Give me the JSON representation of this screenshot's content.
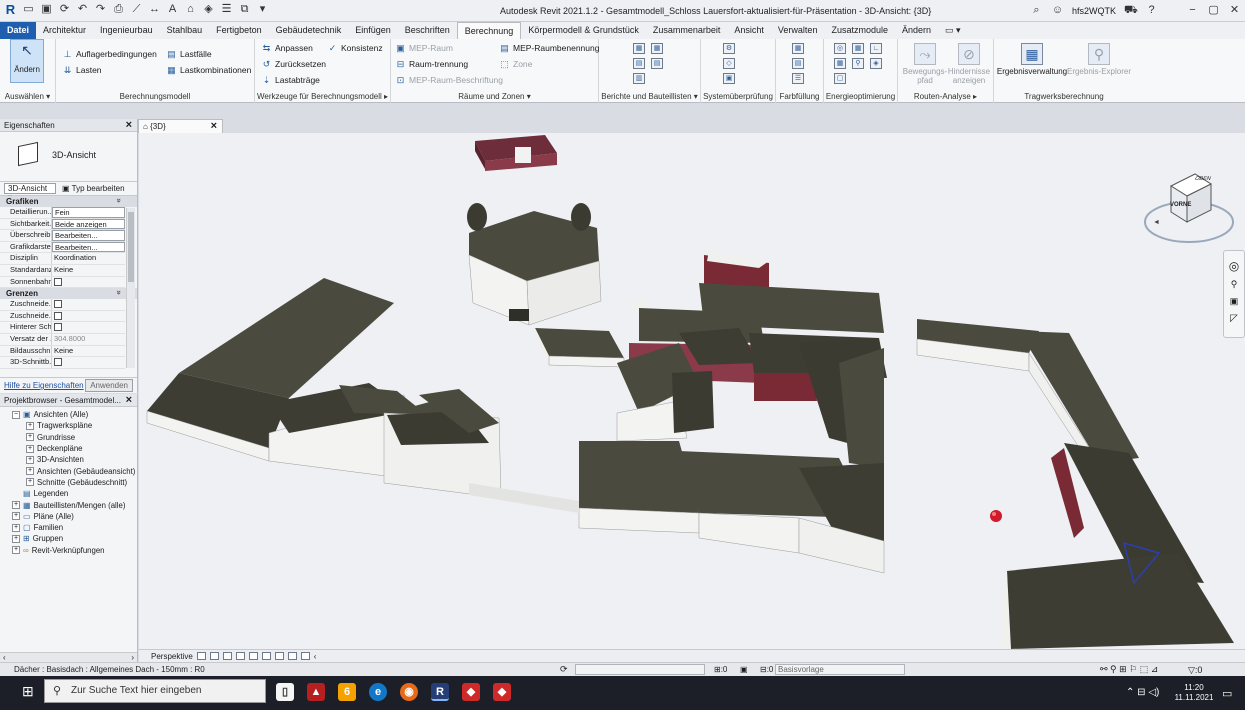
{
  "app": {
    "title": "Autodesk Revit 2021.1.2 - Gesamtmodell_Schloss Lauersfort-aktualisiert-für-Präsentation - 3D-Ansicht: {3D}",
    "user": "hfs2WQTK"
  },
  "tabs": [
    "Datei",
    "Architektur",
    "Ingenieurbau",
    "Stahlbau",
    "Fertigbeton",
    "Gebäudetechnik",
    "Einfügen",
    "Beschriften",
    "Berechnung",
    "Körpermodell & Grundstück",
    "Zusammenarbeit",
    "Ansicht",
    "Verwalten",
    "Zusatzmodule",
    "Ändern"
  ],
  "active_tab": "Berechnung",
  "ribbon": {
    "modify": "Ändern",
    "select": "Auswählen",
    "g1": {
      "items": [
        "Auflagerbedingungen",
        "Lasten"
      ],
      "items2": [
        "Lastfälle",
        "Lastkombinationen"
      ],
      "label": "Berechnungsmodell"
    },
    "g2": {
      "items": [
        "Anpassen",
        "Zurücksetzen",
        "Lastabträge"
      ],
      "items2": [
        "Konsistenz"
      ],
      "label": "Werkzeuge für Berechnungsmodell"
    },
    "g3": {
      "items": [
        "MEP-Raum",
        "Raum-trennung",
        "MEP-Raum-Beschriftung"
      ],
      "items2": [
        "MEP-Raumbenennung",
        "Zone"
      ],
      "label": "Räume und Zonen"
    },
    "g4": {
      "label": "Berichte und Bauteillisten"
    },
    "g5": {
      "label": "Systemüberprüfung"
    },
    "g6": {
      "label": "Farbfüllung"
    },
    "g7": {
      "label": "Energieoptimierung"
    },
    "g8": {
      "btn1": "Bewegungs-pfad",
      "btn2": "Hindernisse anzeigen",
      "label": "Routen-Analyse"
    },
    "g9": {
      "btn1": "Ergebnisverwaltung",
      "btn2": "Ergebnis-Explorer",
      "label": "Tragwerksberechnung"
    }
  },
  "properties": {
    "title": "Eigenschaften",
    "type_name": "3D-Ansicht",
    "view_select": "3D-Ansicht",
    "edit_type": "Typ bearbeiten",
    "sections": [
      {
        "name": "Grafiken",
        "rows": [
          {
            "k": "Detaillierun...",
            "v": "Fein",
            "box": true
          },
          {
            "k": "Sichtbarkeit...",
            "v": "Beide anzeigen",
            "box": true
          },
          {
            "k": "Überschreib...",
            "v": "Bearbeiten...",
            "box": true
          },
          {
            "k": "Grafikdarste...",
            "v": "Bearbeiten...",
            "box": true
          },
          {
            "k": "Disziplin",
            "v": "Koordination"
          },
          {
            "k": "Standardanz...",
            "v": "Keine"
          },
          {
            "k": "Sonnenbahn",
            "v": "",
            "chk": true
          }
        ]
      },
      {
        "name": "Grenzen",
        "rows": [
          {
            "k": "Zuschneide...",
            "v": "",
            "chk": true
          },
          {
            "k": "Zuschneide...",
            "v": "",
            "chk": true
          },
          {
            "k": "Hinterer Sch...",
            "v": "",
            "chk": true
          },
          {
            "k": "Versatz der ...",
            "v": "304.8000",
            "gray": true
          },
          {
            "k": "Bildausschnitt",
            "v": "Keine"
          },
          {
            "k": "3D-Schnittb...",
            "v": "",
            "chk": true
          }
        ]
      }
    ],
    "help": "Hilfe zu Eigenschaften",
    "apply": "Anwenden"
  },
  "browser": {
    "title": "Projektbrowser - Gesamtmodel...",
    "nodes": [
      {
        "label": "Ansichten (Alle)",
        "lvl": 0,
        "tg": "−",
        "ic": "views"
      },
      {
        "label": "Tragwerkspläne",
        "lvl": 1,
        "tg": "+"
      },
      {
        "label": "Grundrisse",
        "lvl": 1,
        "tg": "+"
      },
      {
        "label": "Deckenpläne",
        "lvl": 1,
        "tg": "+"
      },
      {
        "label": "3D-Ansichten",
        "lvl": 1,
        "tg": "+"
      },
      {
        "label": "Ansichten (Gebäudeansicht)",
        "lvl": 1,
        "tg": "+"
      },
      {
        "label": "Schnitte (Gebäudeschnitt)",
        "lvl": 1,
        "tg": "+"
      },
      {
        "label": "Legenden",
        "lvl": 0,
        "tg": "",
        "ic": "leg"
      },
      {
        "label": "Bauteillisten/Mengen (alle)",
        "lvl": 0,
        "tg": "+",
        "ic": "sched"
      },
      {
        "label": "Pläne (Alle)",
        "lvl": 0,
        "tg": "+",
        "ic": "sheet"
      },
      {
        "label": "Familien",
        "lvl": 0,
        "tg": "+",
        "ic": "fam"
      },
      {
        "label": "Gruppen",
        "lvl": 0,
        "tg": "+",
        "ic": "grp"
      },
      {
        "label": "Revit-Verknüpfungen",
        "lvl": 0,
        "tg": "+",
        "ic": "link"
      }
    ]
  },
  "view": {
    "tab": "{3D}",
    "cube_top": "OBEN",
    "cube_front": "VORNE",
    "bar_mode": "Perspektive"
  },
  "status": {
    "left": "Dächer : Basisdach : Allgemeines Dach - 150mm : R0",
    "zero": ":0",
    "zero2": ":0",
    "template": "Basisvorlage"
  },
  "taskbar": {
    "search": "Zur Suche Text hier eingeben",
    "time": "11:20",
    "date": "11.11.2021"
  },
  "colors": {
    "accent": "#1d5fae",
    "roof": "#4a4a3e",
    "wall": "#f4f4f2",
    "brick": "#7a2a35"
  }
}
